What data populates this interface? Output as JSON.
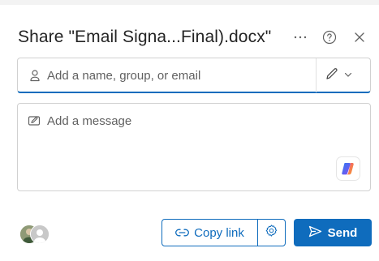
{
  "dialog": {
    "title": "Share \"Email Signa...Final).docx\""
  },
  "header_icons": [
    "more-icon",
    "help-icon",
    "close-icon"
  ],
  "recipients": {
    "placeholder": "Add a name, group, or email",
    "icon": "person-icon",
    "permission_icon": "pencil-icon"
  },
  "message": {
    "placeholder": "Add a message",
    "icon": "edit-message-icon",
    "copilot_icon": "copilot-icon"
  },
  "footer": {
    "copy_link_label": "Copy link",
    "send_label": "Send"
  },
  "colors": {
    "accent": "#0f6cbd",
    "text": "#242424",
    "muted": "#616161",
    "border": "#d1d1d1"
  }
}
